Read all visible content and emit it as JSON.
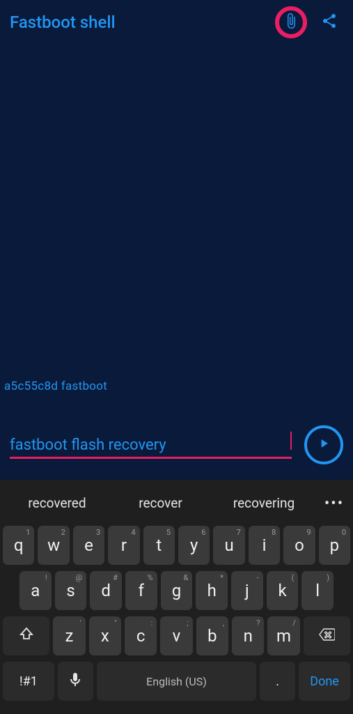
{
  "header": {
    "title": "Fastboot shell"
  },
  "terminal": {
    "device_line": "a5c55c8d fastboot",
    "command": "fastboot flash recovery"
  },
  "suggestions": [
    "recovered",
    "recover",
    "recovering"
  ],
  "keyboard": {
    "row1": [
      {
        "k": "q",
        "s": "1"
      },
      {
        "k": "w",
        "s": "2"
      },
      {
        "k": "e",
        "s": "3"
      },
      {
        "k": "r",
        "s": "4"
      },
      {
        "k": "t",
        "s": "5"
      },
      {
        "k": "y",
        "s": "6"
      },
      {
        "k": "u",
        "s": "7"
      },
      {
        "k": "i",
        "s": "8"
      },
      {
        "k": "o",
        "s": "9"
      },
      {
        "k": "p",
        "s": "0"
      }
    ],
    "row2": [
      {
        "k": "a",
        "s": "!"
      },
      {
        "k": "s",
        "s": "@"
      },
      {
        "k": "d",
        "s": "#"
      },
      {
        "k": "f",
        "s": "%"
      },
      {
        "k": "g",
        "s": "&"
      },
      {
        "k": "h",
        "s": "*"
      },
      {
        "k": "j",
        "s": "-"
      },
      {
        "k": "k",
        "s": "("
      },
      {
        "k": "l",
        "s": ")"
      }
    ],
    "row3": [
      {
        "k": "z",
        "s": "'"
      },
      {
        "k": "x",
        "s": "\""
      },
      {
        "k": "c",
        "s": ":"
      },
      {
        "k": "v",
        "s": ";"
      },
      {
        "k": "b",
        "s": ","
      },
      {
        "k": "n",
        "s": "?"
      },
      {
        "k": "m",
        "s": "/"
      }
    ],
    "sym_key": "!#1",
    "space_label": "English (US)",
    "period_key": ".",
    "done_label": "Done"
  }
}
